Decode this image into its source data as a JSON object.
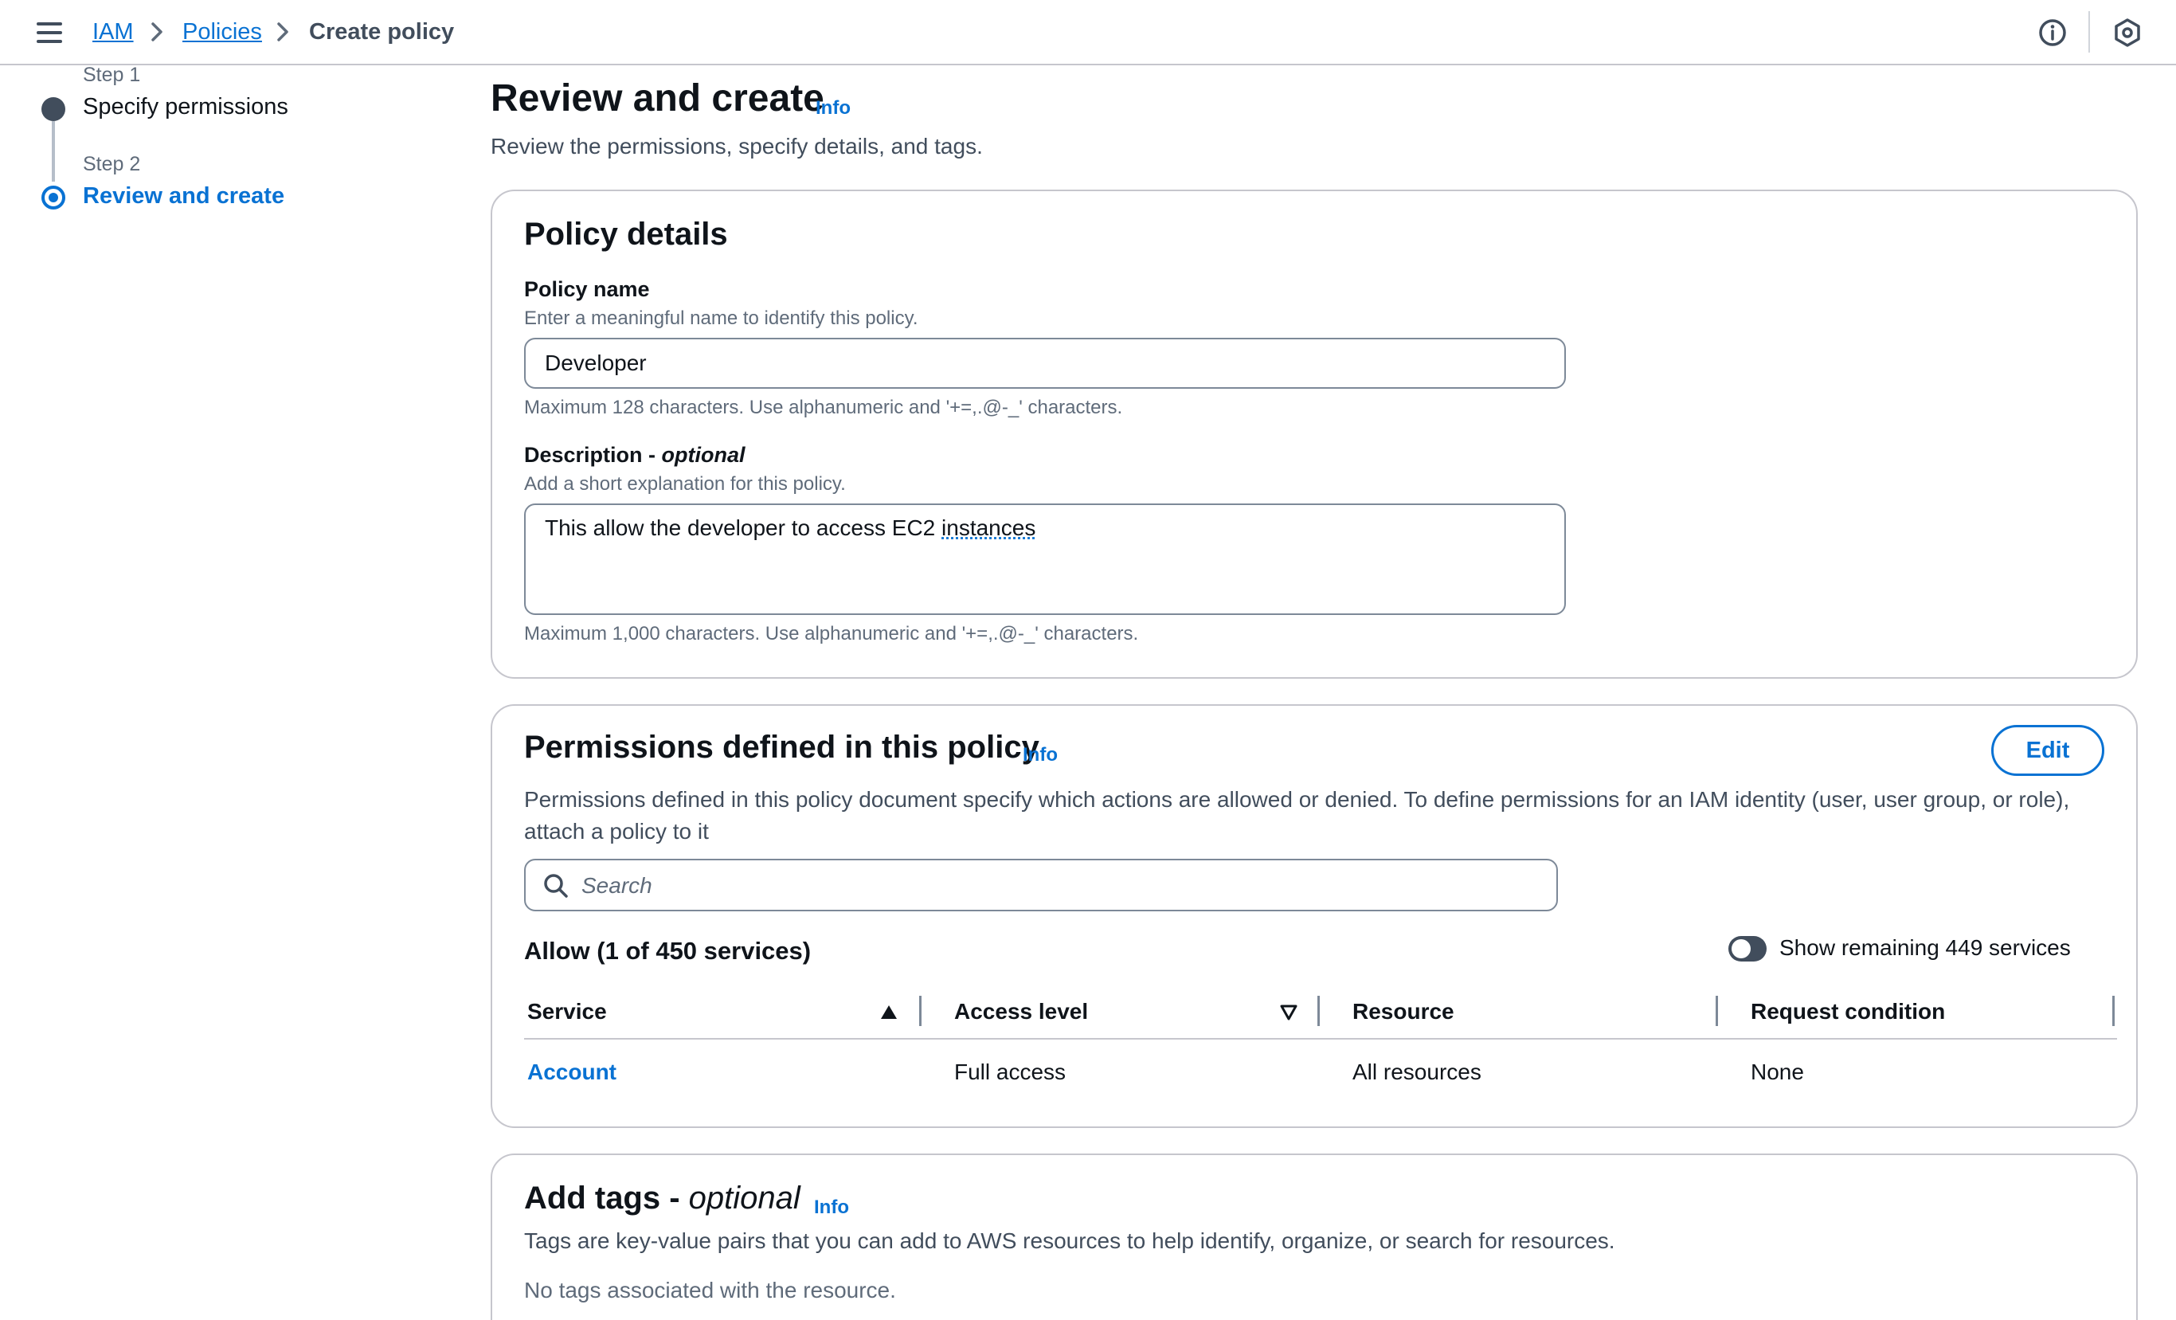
{
  "breadcrumb": {
    "items": [
      "IAM",
      "Policies"
    ],
    "current": "Create policy"
  },
  "steps": [
    {
      "label": "Step 1",
      "title": "Specify permissions"
    },
    {
      "label": "Step 2",
      "title": "Review and create"
    }
  ],
  "page": {
    "title": "Review and create",
    "info": "Info",
    "subtitle": "Review the permissions, specify details, and tags."
  },
  "policy_details": {
    "title": "Policy details",
    "name_label": "Policy name",
    "name_desc": "Enter a meaningful name to identify this policy.",
    "name_value": "Developer",
    "name_constraint": "Maximum 128 characters. Use alphanumeric and '+=,.@-_' characters.",
    "desc_label": "Description - ",
    "desc_label_optional": "optional",
    "desc_desc": "Add a short explanation for this policy.",
    "desc_value_start": "This allow the developer to access EC2 ",
    "desc_value_underlined": "instances",
    "desc_constraint": "Maximum 1,000 characters. Use alphanumeric and '+=,.@-_' characters."
  },
  "permissions": {
    "title": "Permissions defined in this policy",
    "info": "Info",
    "edit_label": "Edit",
    "description": "Permissions defined in this policy document specify which actions are allowed or denied. To define permissions for an IAM identity (user, user group, or role), attach a policy to it",
    "search_placeholder": "Search",
    "allow_title": "Allow (1 of 450 services)",
    "toggle_label": "Show remaining 449 services",
    "columns": [
      "Service",
      "Access level",
      "Resource",
      "Request condition"
    ],
    "rows": [
      {
        "service": "Account",
        "access_level": "Full access",
        "resource": "All resources",
        "condition": "None"
      }
    ]
  },
  "tags": {
    "title": "Add tags - ",
    "title_optional": "optional",
    "info": "Info",
    "description": "Tags are key-value pairs that you can add to AWS resources to help identify, organize, or search for resources.",
    "empty": "No tags associated with the resource."
  },
  "colors": {
    "link": "#0972d3",
    "text": "#0f141a",
    "secondary_text": "#5f6b7a",
    "border": "#c6c6cd"
  },
  "icons": [
    "menu-icon",
    "chevron-right-icon",
    "info-circle-icon",
    "settings-hexagon-icon",
    "search-icon",
    "sort-ascending-icon",
    "sort-descending-icon"
  ]
}
